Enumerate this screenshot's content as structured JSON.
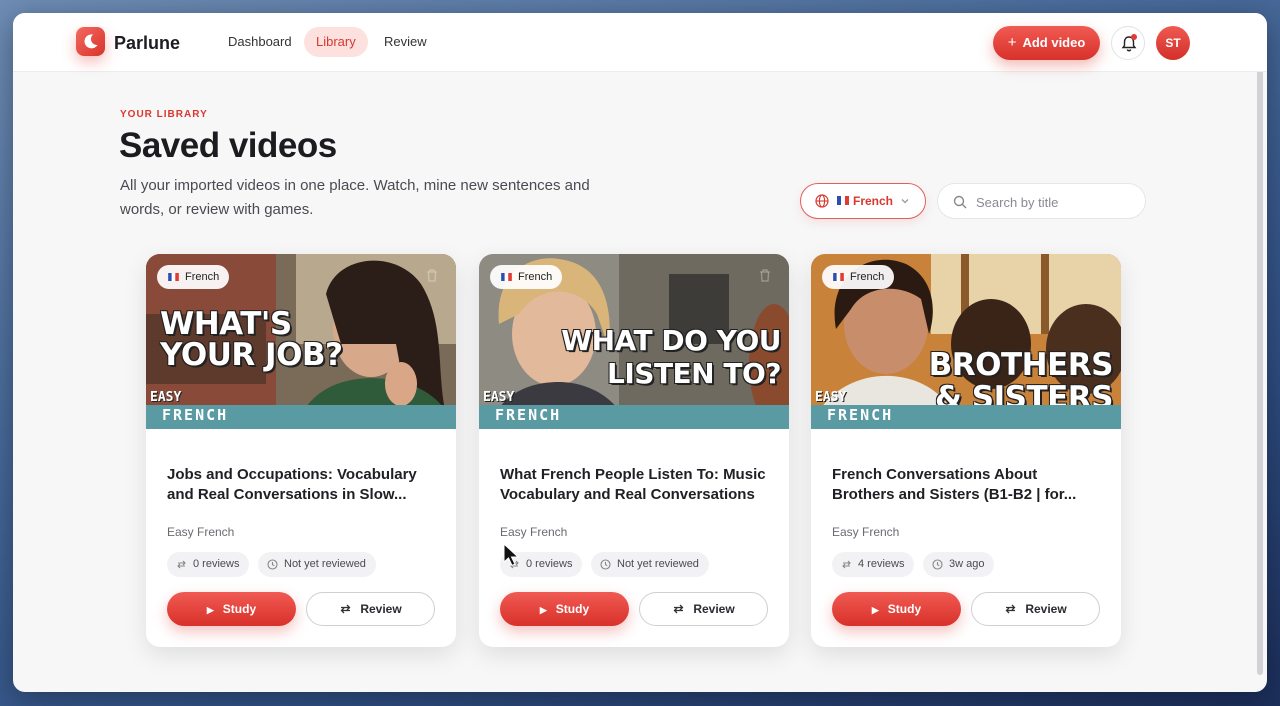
{
  "app": {
    "name": "Parlune"
  },
  "nav": {
    "items": [
      {
        "label": "Dashboard",
        "active": false
      },
      {
        "label": "Library",
        "active": true
      },
      {
        "label": "Review",
        "active": false
      }
    ]
  },
  "header": {
    "add_video_label": "Add video",
    "avatar_initials": "ST",
    "bell_icon": "bell-icon",
    "has_notification": true
  },
  "page": {
    "eyebrow": "YOUR LIBRARY",
    "title": "Saved videos",
    "subtitle": "All your imported videos in one place. Watch, mine new sentences and words, or review with games."
  },
  "filters": {
    "language": "French",
    "search_placeholder": "Search by title"
  },
  "colors": {
    "accent": "#e0382f",
    "accent_light": "#fde1df",
    "teal": "#5a9ba3"
  },
  "cards": [
    {
      "badge": "French",
      "thumb_line1": "WHAT'S",
      "thumb_line2": "YOUR JOB?",
      "thumb_brand_top": "EASY",
      "thumb_brand_bottom": "FRENCH",
      "title": "Jobs and Occupations: Vocabulary and Real Conversations in Slow...",
      "channel": "Easy French",
      "reviews": "0 reviews",
      "status": "Not yet reviewed",
      "study_label": "Study",
      "review_label": "Review"
    },
    {
      "badge": "French",
      "thumb_line1": "WHAT DO YOU",
      "thumb_line2": "LISTEN TO?",
      "thumb_brand_top": "EASY",
      "thumb_brand_bottom": "FRENCH",
      "title": "What French People Listen To: Music Vocabulary and Real Conversations",
      "channel": "Easy French",
      "reviews": "0 reviews",
      "status": "Not yet reviewed",
      "study_label": "Study",
      "review_label": "Review"
    },
    {
      "badge": "French",
      "thumb_line1": "BROTHERS",
      "thumb_line2": "& SISTERS",
      "thumb_brand_top": "EASY",
      "thumb_brand_bottom": "FRENCH",
      "title": "French Conversations About Brothers and Sisters (B1-B2 | for...",
      "channel": "Easy French",
      "reviews": "4 reviews",
      "status": "3w ago",
      "study_label": "Study",
      "review_label": "Review"
    }
  ]
}
